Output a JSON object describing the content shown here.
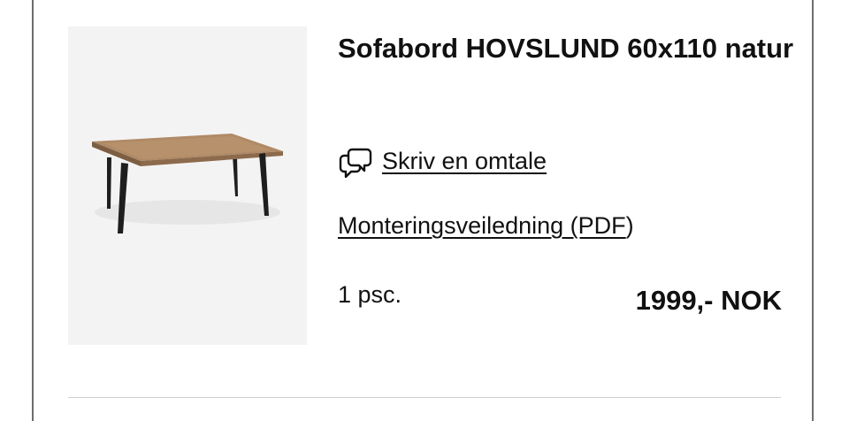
{
  "product": {
    "title": "Sofabord HOVSLUND 60x110 natur",
    "image_alt": "Sofabord HOVSLUND",
    "image_icon": "coffee-table-illustration",
    "review_icon": "speech-bubbles-icon",
    "review_link": "Skriv en omtale",
    "manual_link": "Monteringsveiledning (PDF",
    "manual_link_suffix": ")",
    "quantity": "1 psc.",
    "price": "1999,- NOK"
  },
  "colors": {
    "text": "#111111",
    "image_background": "#f3f3f3",
    "border": "#6e6e6e",
    "divider": "#d0d0d0"
  }
}
